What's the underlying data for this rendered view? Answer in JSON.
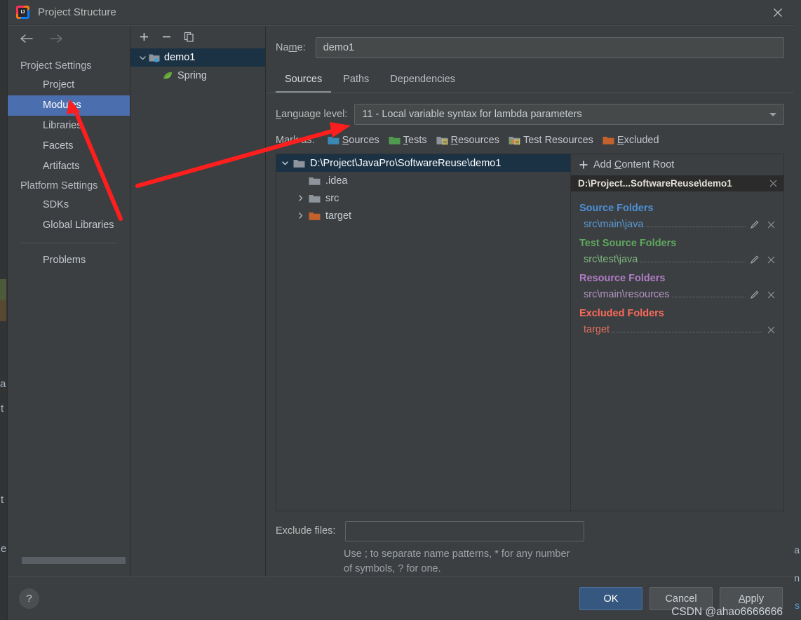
{
  "window": {
    "title": "Project Structure",
    "logo_icon": "intellij-idea-logo",
    "close_icon": "close-icon"
  },
  "sidebar": {
    "back_icon": "arrow-left-icon",
    "forward_icon": "arrow-right-icon",
    "groups": [
      {
        "label": "Project Settings",
        "items": [
          {
            "label": "Project",
            "selected": false
          },
          {
            "label": "Modules",
            "selected": true
          },
          {
            "label": "Libraries",
            "selected": false
          },
          {
            "label": "Facets",
            "selected": false
          },
          {
            "label": "Artifacts",
            "selected": false
          }
        ]
      },
      {
        "label": "Platform Settings",
        "items": [
          {
            "label": "SDKs",
            "selected": false
          },
          {
            "label": "Global Libraries",
            "selected": false
          }
        ]
      }
    ],
    "problems_label": "Problems"
  },
  "modules_panel": {
    "toolbar": {
      "add_icon": "plus-icon",
      "remove_icon": "minus-icon",
      "copy_icon": "copy-icon"
    },
    "tree": [
      {
        "label": "demo1",
        "icon": "module-folder-icon",
        "selected": true,
        "expanded": true
      },
      {
        "label": "Spring",
        "icon": "spring-leaf-icon",
        "selected": false
      }
    ]
  },
  "main": {
    "name": {
      "label_pre": "Na",
      "label_mnemonic": "m",
      "label_post": "e:",
      "value": "demo1",
      "placeholder": ""
    },
    "tabs": [
      {
        "label": "Sources",
        "active": true
      },
      {
        "label": "Paths",
        "active": false
      },
      {
        "label": "Dependencies",
        "active": false
      }
    ],
    "language_level": {
      "label_mnemonic": "L",
      "label_post": "anguage level:",
      "value": "11 - Local variable syntax for lambda parameters",
      "arrow_icon": "chevron-down-icon"
    },
    "mark_as": {
      "label": "Mark as:",
      "options": [
        {
          "mnemonic": "S",
          "rest": "ources",
          "icon": "folder-blue-icon",
          "color": "#3b88b5"
        },
        {
          "mnemonic": "T",
          "rest": "ests",
          "icon": "folder-green-icon",
          "color": "#4f9a4f"
        },
        {
          "mnemonic": "R",
          "rest": "esources",
          "icon": "folder-resources-icon",
          "color": "#8d949b"
        },
        {
          "mnemonic": "",
          "rest": "Test Resources",
          "icon": "folder-test-resources-icon",
          "color": "#8d949b"
        },
        {
          "mnemonic": "E",
          "rest": "xcluded",
          "icon": "folder-orange-icon",
          "color": "#c4622d"
        }
      ]
    },
    "content_tree": [
      {
        "label": "D:\\Project\\JavaPro\\SoftwareReuse\\demo1",
        "icon": "folder-grey-icon",
        "twisty": "expanded",
        "selected": true,
        "indent": 0
      },
      {
        "label": ".idea",
        "icon": "folder-grey-icon",
        "twisty": "none",
        "selected": false,
        "indent": 1
      },
      {
        "label": "src",
        "icon": "folder-grey-icon",
        "twisty": "collapsed",
        "selected": false,
        "indent": 1
      },
      {
        "label": "target",
        "icon": "folder-orange-icon",
        "twisty": "collapsed",
        "selected": false,
        "indent": 1
      }
    ],
    "exclude_files": {
      "label": "Exclude files:",
      "value": "",
      "placeholder": "",
      "hint": "Use ; to separate name patterns, * for any number of symbols, ? for one."
    }
  },
  "roots_panel": {
    "add_content_root": {
      "plus_icon": "plus-icon",
      "label_pre": "Add ",
      "label_mnemonic": "C",
      "label_post": "ontent Root"
    },
    "content_root_header": {
      "label": "D:\\Project...SoftwareReuse\\demo1",
      "close_icon": "close-icon"
    },
    "sections": [
      {
        "title": "Source Folders",
        "kind": "src",
        "entries": [
          {
            "path": "src\\main\\java",
            "edit_icon": "pencil-icon",
            "remove_icon": "close-icon"
          }
        ]
      },
      {
        "title": "Test Source Folders",
        "kind": "test",
        "entries": [
          {
            "path": "src\\test\\java",
            "edit_icon": "pencil-icon",
            "remove_icon": "close-icon"
          }
        ]
      },
      {
        "title": "Resource Folders",
        "kind": "res",
        "entries": [
          {
            "path": "src\\main\\resources",
            "edit_icon": "pencil-icon",
            "remove_icon": "close-icon"
          }
        ]
      },
      {
        "title": "Excluded Folders",
        "kind": "exc",
        "entries": [
          {
            "path": "target",
            "edit_icon": "",
            "remove_icon": "close-icon"
          }
        ]
      }
    ]
  },
  "footer": {
    "help_icon": "question-mark-icon",
    "help_label": "?",
    "ok_label": "OK",
    "cancel_label": "Cancel",
    "apply_label_mnemonic": "A",
    "apply_label_post": "pply",
    "watermark": "CSDN @ahao6666666"
  },
  "background_fragments": {
    "left": [
      "a",
      "t",
      "t",
      "e"
    ],
    "right": [
      "ra",
      "in",
      "s"
    ]
  },
  "colors": {
    "dialog_bg": "#3c3f41",
    "selection_blue": "#4b6eaf",
    "tree_selection": "#1b3244",
    "primary_button": "#365880",
    "source_folder": "#4d90d6",
    "test_source_folder": "#5fa85f",
    "resource_folder": "#b07cc6",
    "excluded_folder": "#fa6a5a",
    "annotation_arrow": "#ff1e1e"
  }
}
